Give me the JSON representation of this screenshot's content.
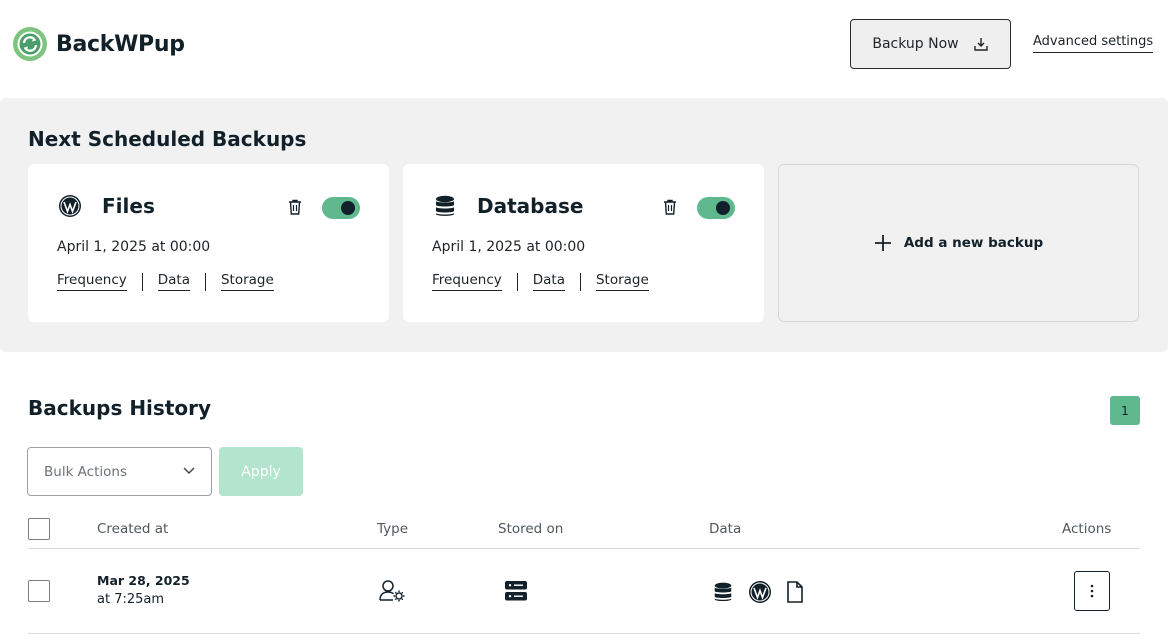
{
  "header": {
    "brand": "BackWPup",
    "backup_now": "Backup Now",
    "advanced_settings": "Advanced settings"
  },
  "scheduled": {
    "title": "Next Scheduled Backups",
    "cards": [
      {
        "title": "Files",
        "icon": "wordpress-icon",
        "enabled": true,
        "date": "April 1, 2025 at 00:00",
        "links": [
          "Frequency",
          "Data",
          "Storage"
        ]
      },
      {
        "title": "Database",
        "icon": "database-icon",
        "enabled": true,
        "date": "April 1, 2025 at 00:00",
        "links": [
          "Frequency",
          "Data",
          "Storage"
        ]
      }
    ],
    "add_label": "Add a new backup"
  },
  "history": {
    "title": "Backups History",
    "page": "1",
    "bulk_actions": "Bulk Actions",
    "apply": "Apply",
    "columns": [
      "Created at",
      "Type",
      "Stored on",
      "Data",
      "Actions"
    ],
    "rows": [
      {
        "date": "Mar 28, 2025",
        "time": "at 7:25am",
        "type_icon": "user-gear-icon",
        "stored_icon": "server-icon",
        "data_icons": [
          "database-icon",
          "wordpress-icon",
          "file-icon"
        ]
      }
    ]
  },
  "colors": {
    "accent": "#5fb88e",
    "accent_light": "#b3e4cd",
    "panel": "#f0f1f0",
    "text_dark": "#12202a"
  }
}
